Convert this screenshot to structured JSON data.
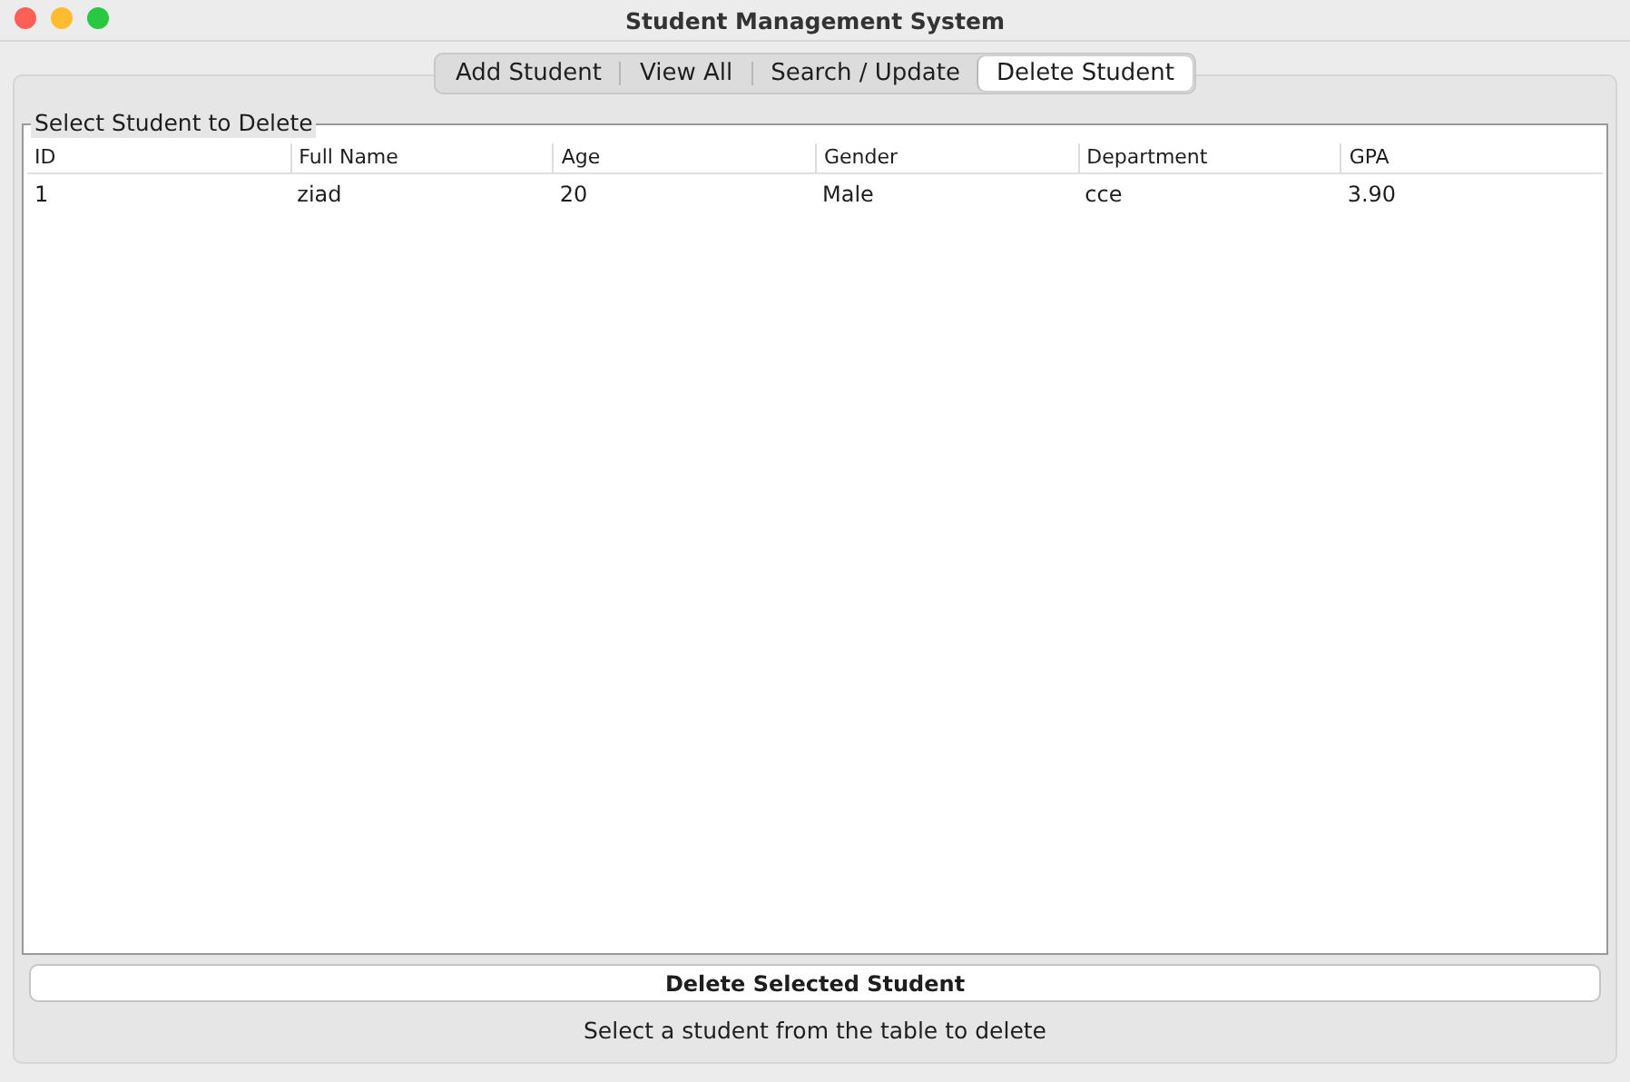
{
  "window": {
    "title": "Student Management System"
  },
  "tabs": [
    {
      "label": "Add Student",
      "selected": false
    },
    {
      "label": "View All",
      "selected": false
    },
    {
      "label": "Search / Update",
      "selected": false
    },
    {
      "label": "Delete Student",
      "selected": true
    }
  ],
  "group": {
    "title": "Select Student to Delete"
  },
  "table": {
    "columns": [
      "ID",
      "Full Name",
      "Age",
      "Gender",
      "Department",
      "GPA"
    ],
    "rows": [
      {
        "cells": [
          "1",
          "ziad",
          "20",
          "Male",
          "cce",
          "3.90"
        ],
        "selected": false
      }
    ]
  },
  "delete_button": "Delete Selected Student",
  "status": "Select a student from the table to delete"
}
